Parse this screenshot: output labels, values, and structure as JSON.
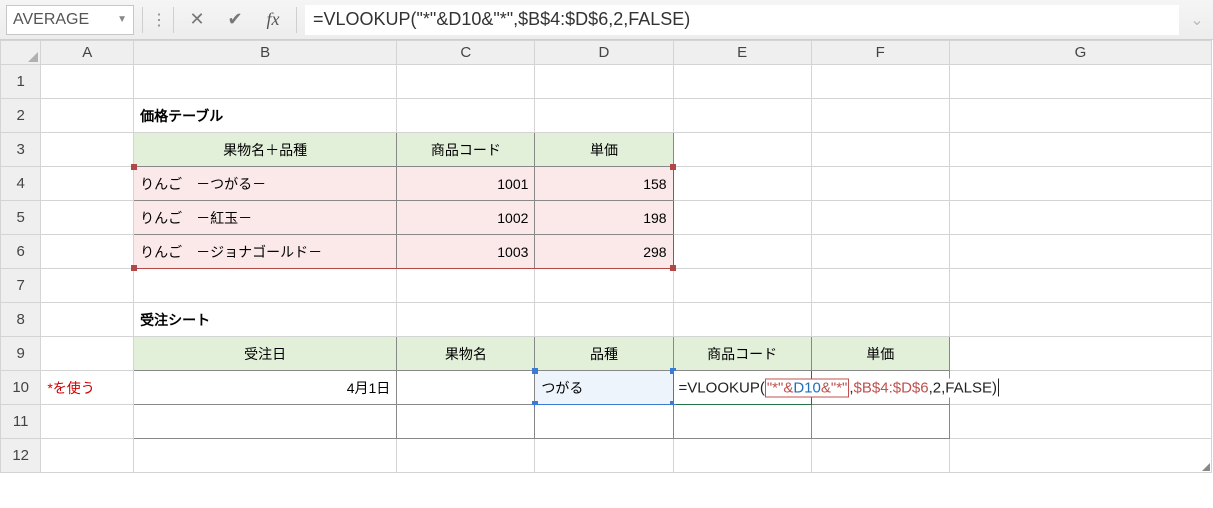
{
  "formula_bar": {
    "name_box": "AVERAGE",
    "formula": "=VLOOKUP(\"*\"&D10&\"*\",$B$4:$D$6,2,FALSE)"
  },
  "columns": [
    "A",
    "B",
    "C",
    "D",
    "E",
    "F",
    "G"
  ],
  "rows": [
    "1",
    "2",
    "3",
    "4",
    "5",
    "6",
    "7",
    "8",
    "9",
    "10",
    "11",
    "12"
  ],
  "titles": {
    "price_table": "価格テーブル",
    "order_sheet": "受注シート"
  },
  "price_table": {
    "headers": {
      "name": "果物名＋品種",
      "code": "商品コード",
      "price": "単価"
    },
    "rows": [
      {
        "name": "りんご　－つがる－",
        "code": "1001",
        "price": "158"
      },
      {
        "name": "りんご　－紅玉－",
        "code": "1002",
        "price": "198"
      },
      {
        "name": "りんご　－ジョナゴールド－",
        "code": "1003",
        "price": "298"
      }
    ]
  },
  "order_sheet": {
    "headers": {
      "date": "受注日",
      "fruit": "果物名",
      "variety": "品種",
      "code": "商品コード",
      "price": "単価"
    },
    "row10": {
      "note": "*を使う",
      "date": "4月1日",
      "fruit": "",
      "variety": "つがる"
    }
  },
  "inline_formula": {
    "p1": "=VLOOKUP(",
    "p2": "\"*\"&",
    "p3": "D10",
    "p4": "&\"*\"",
    "p5": ",",
    "p6": "$B$4:$D$6",
    "p7": ",2,FALSE)"
  },
  "chart_data": {
    "type": "table",
    "title": "価格テーブル",
    "columns": [
      "果物名＋品種",
      "商品コード",
      "単価"
    ],
    "rows": [
      [
        "りんご　－つがる－",
        1001,
        158
      ],
      [
        "りんご　－紅玉－",
        1002,
        198
      ],
      [
        "りんご　－ジョナゴールド－",
        1003,
        298
      ]
    ]
  }
}
